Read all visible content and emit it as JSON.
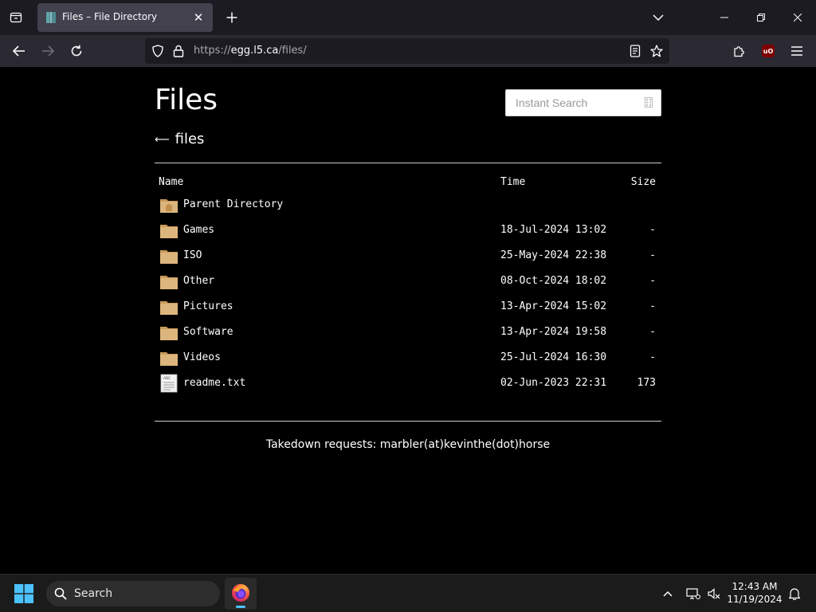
{
  "browser": {
    "tab": {
      "title": "Files – File Directory"
    },
    "address": {
      "scheme": "https://",
      "host": "egg.l5.ca",
      "path": "/files/"
    },
    "extension_badge": "uO"
  },
  "page": {
    "title": "Files",
    "search": {
      "placeholder": "Instant Search"
    },
    "breadcrumb": {
      "arrow": "⟵",
      "label": "files"
    },
    "table": {
      "headers": {
        "name": "Name",
        "time": "Time",
        "size": "Size"
      },
      "rows": [
        {
          "name": "Parent Directory",
          "time": "",
          "size": "",
          "icon": "parent-folder-icon"
        },
        {
          "name": "Games",
          "time": "18-Jul-2024 13:02",
          "size": "-",
          "icon": "folder-icon"
        },
        {
          "name": "ISO",
          "time": "25-May-2024 22:38",
          "size": "-",
          "icon": "folder-icon"
        },
        {
          "name": "Other",
          "time": "08-Oct-2024 18:02",
          "size": "-",
          "icon": "folder-icon"
        },
        {
          "name": "Pictures",
          "time": "13-Apr-2024 15:02",
          "size": "-",
          "icon": "folder-icon"
        },
        {
          "name": "Software",
          "time": "13-Apr-2024 19:58",
          "size": "-",
          "icon": "folder-icon"
        },
        {
          "name": "Videos",
          "time": "25-Jul-2024 16:30",
          "size": "-",
          "icon": "folder-icon"
        },
        {
          "name": "readme.txt",
          "time": "02-Jun-2023 22:31",
          "size": "173",
          "icon": "text-file-icon"
        }
      ]
    },
    "footer": "Takedown requests: marbler(at)kevinthe(dot)horse"
  },
  "taskbar": {
    "search_label": "Search",
    "time": "12:43 AM",
    "date": "11/19/2024"
  },
  "colors": {
    "page_bg": "#000000",
    "tabstrip_bg": "#1c1b22",
    "navbar_bg": "#2b2a33",
    "folder": "#d9b37a",
    "taskbar_bg": "#1b1b1b"
  }
}
